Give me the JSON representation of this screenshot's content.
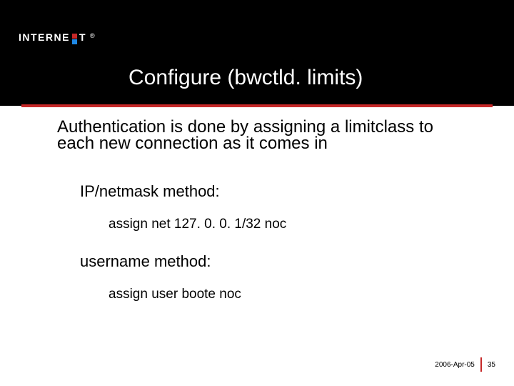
{
  "logo": {
    "word_left": "INTERNE",
    "word_right": "T",
    "reg": "®"
  },
  "title": "Configure (bwctld. limits)",
  "intro": "Authentication is done by assigning a limitclass to each new connection as it comes in",
  "method1_label": "IP/netmask method:",
  "method1_code": "assign net 127. 0. 0. 1/32 noc",
  "method2_label": "username method:",
  "method2_code": "assign user boote noc",
  "footer": {
    "date": "2006-Apr-05",
    "page": "35"
  }
}
